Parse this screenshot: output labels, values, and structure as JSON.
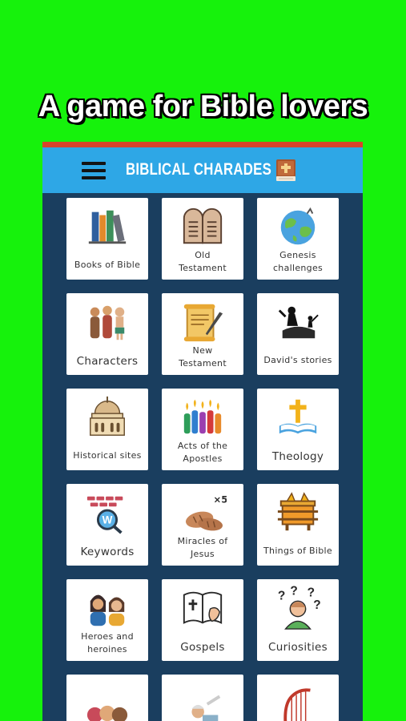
{
  "promo": {
    "headline": "A game for Bible lovers"
  },
  "app": {
    "title": "BIBLICAL CHARADES",
    "menu_icon": "hamburger-menu-icon",
    "title_icon": "bible-book-icon"
  },
  "categories": [
    {
      "label": "Books of Bible",
      "icon": "books-icon"
    },
    {
      "label": "Old\nTestament",
      "icon": "stone-tablets-icon"
    },
    {
      "label": "Genesis\nchallenges",
      "icon": "earth-globe-icon"
    },
    {
      "label": "Characters",
      "icon": "biblical-people-icon"
    },
    {
      "label": "New\nTestament",
      "icon": "scroll-quill-icon"
    },
    {
      "label": "David's stories",
      "icon": "david-goliath-icon"
    },
    {
      "label": "Historical sites",
      "icon": "temple-dome-icon"
    },
    {
      "label": "Acts of the\nApostles",
      "icon": "pentecost-flames-icon"
    },
    {
      "label": "Theology",
      "icon": "cross-open-bible-icon"
    },
    {
      "label": "Keywords",
      "icon": "keyboard-search-icon"
    },
    {
      "label": "Miracles of\nJesus",
      "icon": "loaves-bread-icon",
      "badge": "×5"
    },
    {
      "label": "Things of Bible",
      "icon": "ark-covenant-icon"
    },
    {
      "label": "Heroes and\nheroines",
      "icon": "heroes-people-icon"
    },
    {
      "label": "Gospels",
      "icon": "gospel-book-icon"
    },
    {
      "label": "Curiosities",
      "icon": "question-marks-person-icon"
    },
    {
      "label": "",
      "icon": "group-people-icon"
    },
    {
      "label": "",
      "icon": "elder-person-icon"
    },
    {
      "label": "",
      "icon": "harp-icon"
    }
  ],
  "colors": {
    "background": "#16f20c",
    "appbar": "#2ea7e6",
    "accent_strip": "#d8432b",
    "grid_background": "#1a3e5f",
    "tile": "#ffffff"
  }
}
